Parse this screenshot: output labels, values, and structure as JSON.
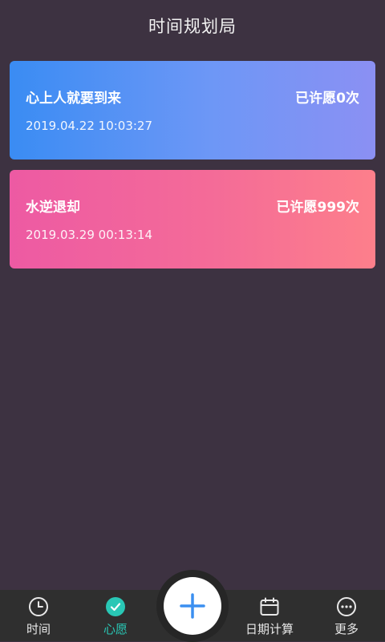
{
  "header": {
    "title": "时间规划局"
  },
  "wishes": [
    {
      "name": "心上人就要到来",
      "count": "已许愿0次",
      "time": "2019.04.22 10:03:27"
    },
    {
      "name": "水逆退却",
      "count": "已许愿999次",
      "time": "2019.03.29 00:13:14"
    }
  ],
  "tabbar": {
    "tabs": [
      {
        "label": "时间",
        "icon": "clock-icon",
        "active": false
      },
      {
        "label": "心愿",
        "icon": "check-circle-icon",
        "active": true
      },
      {
        "label": "日期计算",
        "icon": "calendar-icon",
        "active": false
      },
      {
        "label": "更多",
        "icon": "more-dots-icon",
        "active": false
      }
    ],
    "add_icon": "plus-icon"
  },
  "colors": {
    "background": "#3d3241",
    "accent": "#29c7b5",
    "add_blue": "#3b8ff0",
    "card1_start": "#3a8cf3",
    "card1_end": "#8b90f3",
    "card2_start": "#ed5aa3",
    "card2_end": "#fd7f8b"
  }
}
